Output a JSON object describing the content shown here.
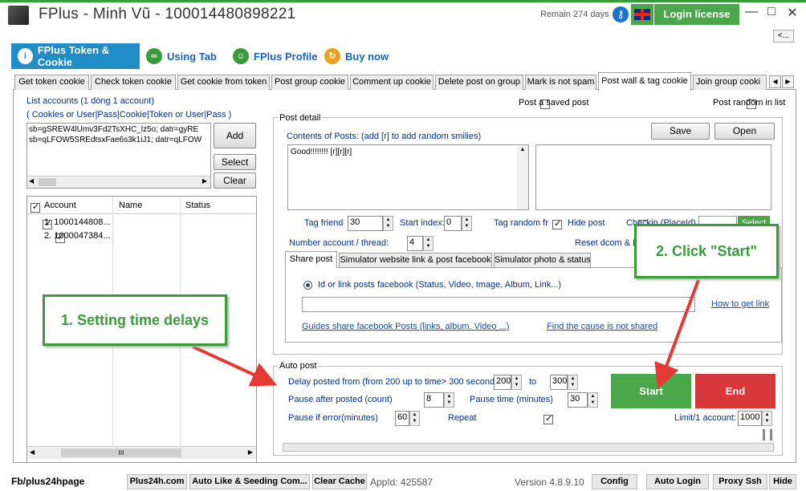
{
  "window": {
    "title": "FPlus - Minh Vũ - 100014480898221",
    "remain": "Remain 274 days",
    "login_label": "Login license",
    "minimize": "—",
    "maximize": "□",
    "close": "✕",
    "back": "<..."
  },
  "nav": {
    "tabs": [
      "FPlus Token & Cookie",
      "Using Tab",
      "FPlus Profile",
      "Buy now"
    ]
  },
  "subtabs": [
    "Get token cookie",
    "Check token cookie",
    "Get cookie from token",
    "Post group cookie",
    "Comment up cookie",
    "Delete post on group",
    "Mark is not spam",
    "Post wall & tag cookie",
    "Join group cooki"
  ],
  "accounts": {
    "label1": "List accounts (1 dòng 1 account)",
    "label2": "( Cookies or User|Pass|Cookie|Token or User|Pass )",
    "line1": "sb=gSREW4lUmv3Fd2TsXHC_lz5o; datr=gyRE",
    "line2": "sb=qLFOW5SREdtsxFae6s3k1iJ1; datr=qLFOW",
    "add": "Add",
    "select": "Select",
    "clear": "Clear"
  },
  "grid": {
    "headers": [
      "Account",
      "Name",
      "Status"
    ],
    "rows": [
      {
        "account": "1. 1000144808...",
        "name": "",
        "status": ""
      },
      {
        "account": "2. 1000047384...",
        "name": "",
        "status": ""
      }
    ]
  },
  "post_detail": {
    "title": "Post detail",
    "saved": "Post a saved post",
    "random_list": "Post random in list",
    "contents_label": "Contents of Posts: (add [r] to add random smilies)",
    "save": "Save",
    "open": "Open",
    "content": "Good!!!!!!!! [r][r][r]",
    "tag_friend": "Tag friend",
    "tag_value": "30",
    "start_index": "Start index:",
    "start_value": "0",
    "tag_random": "Tag random fr",
    "hide_post": "Hide post",
    "checkin": "Checkin (PlaceId)",
    "select": "Select",
    "number_account": "Number account / thread:",
    "number_value": "4",
    "reset": "Reset dcom & H"
  },
  "share": {
    "tabs": [
      "Share post",
      "Simulator website link & post facebook",
      "Simulator photo & status"
    ],
    "radio": "Id or link posts facebook (Status, Video, Image, Album, Link...)",
    "how": "How to get link",
    "guides": "Guides share facebook Posts (links, album. Video ...)",
    "find": "Find the cause is not shared"
  },
  "auto_post": {
    "title": "Auto post",
    "delay_label": "Delay posted from (from 200 up to time> 300 seconds)",
    "delay_from": "200",
    "to": "to",
    "delay_to": "300",
    "pause_after": "Pause after posted (count)",
    "pause_count": "8",
    "pause_time": "Pause time (minutes)",
    "pause_time_value": "30",
    "pause_error": "Pause if error(minutes)",
    "pause_error_value": "60",
    "repeat": "Repeat",
    "start": "Start",
    "end": "End",
    "limit": "Limit/1 account:",
    "limit_value": "1000"
  },
  "callouts": {
    "one": "1. Setting time delays",
    "two": "2. Click \"Start\""
  },
  "status": {
    "left": "Fb/plus24hpage",
    "buttons": [
      "Plus24h.com",
      "Auto Like & Seeding Com...",
      "Clear Cache"
    ],
    "appid": "AppId: 425587",
    "version": "Version 4.8.9.10",
    "right": [
      "Config",
      "Auto Login",
      "Proxy Ssh",
      "Hide"
    ]
  },
  "colors": {
    "green": "#4aa84a",
    "red": "#d9383a",
    "blue": "#1f8ec6"
  }
}
